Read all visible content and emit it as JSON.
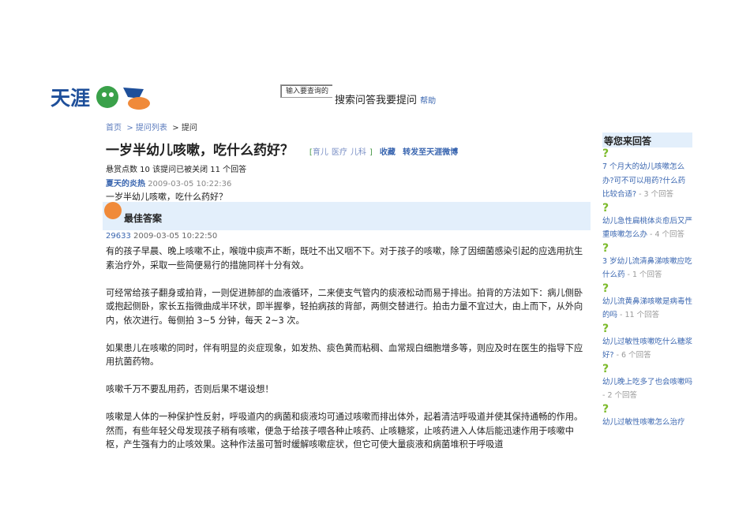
{
  "logo": {
    "text": "天涯问答"
  },
  "search": {
    "placeholder": "输入要查询的",
    "search_label": "搜索问答",
    "ask_label": "我要提问",
    "help_label": "帮助"
  },
  "breadcrumb": {
    "home": "首页",
    "list": "> 提问列表",
    "current": "> 提问"
  },
  "question": {
    "title": "一岁半幼儿咳嗽，吃什么药好？",
    "tag_open": "[",
    "tags": [
      "育儿",
      "医疗",
      "儿科"
    ],
    "tag_close": "]",
    "favorite": "收藏",
    "share": "转发至天涯微博",
    "meta": "悬赏点数  10  该提问已被关闭  11 个回答",
    "asker": "夏天的炎热",
    "asked_time": "2009-03-05 10:22:36",
    "body": "一岁半幼儿咳嗽，吃什么药好？"
  },
  "best": {
    "label": "最佳答案",
    "answerer": "29633",
    "time": "2009-03-05 10:22:50",
    "paragraphs": [
      "有的孩子早晨、晚上咳嗽不止，喉咙中痰声不断，既吐不出又咽不下。对于孩子的咳嗽，除了因细菌感染引起的应选用抗生素治疗外，采取一些简便易行的措施同样十分有效。",
      "可经常给孩子翻身或拍背，一则促进肺部的血液循环，二来使支气管内的痰液松动而易于排出。拍背的方法如下：病儿侧卧或抱起侧卧，家长五指微曲成半环状，即半握拳，轻拍病孩的背部，两侧交替进行。拍击力量不宜过大，由上而下，从外向内，依次进行。每侧拍 3~5 分钟，每天 2~3 次。",
      "如果患儿在咳嗽的同时，伴有明显的炎症现象，如发热、痰色黄而粘稠、血常规白细胞增多等，则应及时在医生的指导下应用抗菌药物。",
      "咳嗽千万不要乱用药，否则后果不堪设想！",
      "咳嗽是人体的一种保护性反射，呼吸道内的病菌和痰液均可通过咳嗽而排出体外，起着清洁呼吸道并使其保持通畅的作用。然而，有些年轻父母发现孩子稍有咳嗽，便急于给孩子喂各种止咳药、止咳糖浆，止咳药进入人体后能迅速作用于咳嗽中枢，产生强有力的止咳效果。这种作法虽可暂时缓解咳嗽症状，但它可使大量痰液和病菌堆积于呼吸道"
    ]
  },
  "sidebar": {
    "title": "等您来回答",
    "items": [
      {
        "q": "7 个月大的幼儿咳嗽怎么办?可不可以用药?什么药比较合适?",
        "count": " - 3 个回答"
      },
      {
        "q": "幼儿急性扁桃体炎愈后又严重咳嗽怎么办 ",
        "count": " - 4 个回答"
      },
      {
        "q": "3 岁幼儿流清鼻涕咳嗽应吃什么药 ",
        "count": " - 1 个回答"
      },
      {
        "q": "幼儿流黄鼻涕咳嗽是病毒性的吗 ",
        "count": " - 11 个回答"
      },
      {
        "q": "幼儿过敏性咳嗽吃什么糖浆好?",
        "count": " - 6 个回答"
      },
      {
        "q": "幼儿晚上吃多了也会咳嗽吗 ",
        "count": " - 2 个回答"
      },
      {
        "q": "幼儿过敏性咳嗽怎么治疗",
        "count": ""
      }
    ]
  }
}
